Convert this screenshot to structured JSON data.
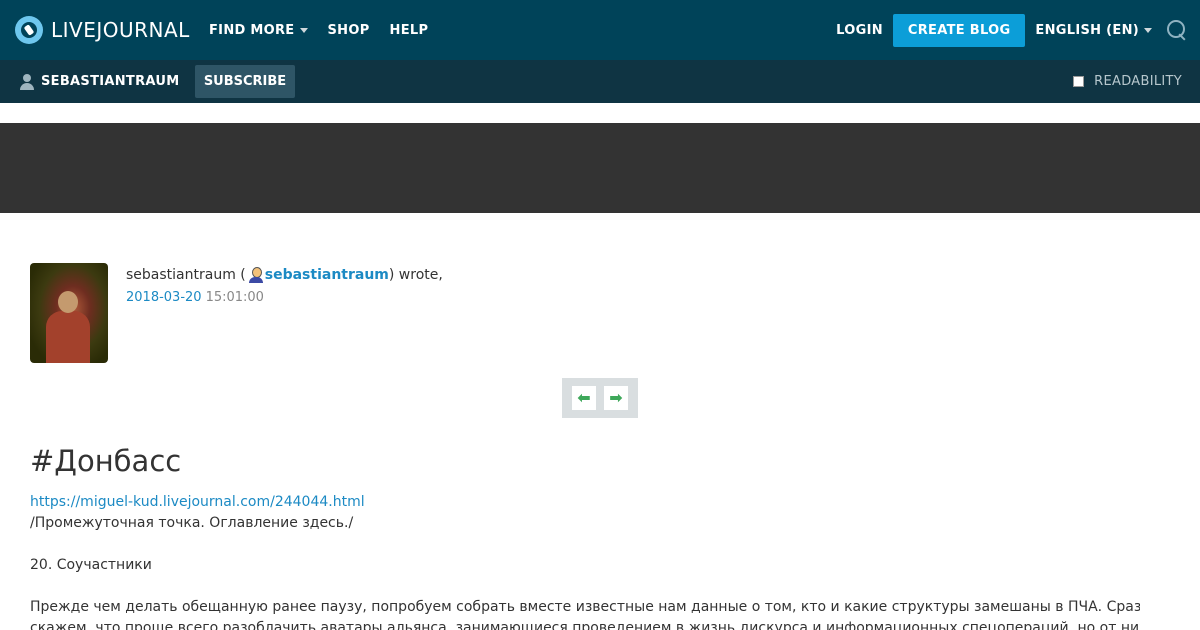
{
  "header": {
    "logo_text": "LIVEJOURNAL",
    "nav": [
      {
        "label": "FIND MORE",
        "has_dropdown": true
      },
      {
        "label": "SHOP",
        "has_dropdown": false
      },
      {
        "label": "HELP",
        "has_dropdown": false
      }
    ],
    "login_label": "LOGIN",
    "create_blog_label": "CREATE BLOG",
    "language_label": "ENGLISH (EN)",
    "icons": {
      "search": "search-icon",
      "logo": "livejournal-logo-icon"
    },
    "colors": {
      "top_bar": "#004359",
      "sub_bar": "#0f3443",
      "accent": "#0c9ed8"
    }
  },
  "subheader": {
    "journal_name": "SEBASTIANTRAUM",
    "subscribe_label": "SUBSCRIBE",
    "readability_label": "READABILITY"
  },
  "entry": {
    "author_display": "sebastiantraum (",
    "author_link": "sebastiantraum",
    "wrote_suffix": ") wrote,",
    "date": "2018-03-20",
    "time": "15:01:00",
    "title": "#Донбасс",
    "source_link": "https://miguel-kud.livejournal.com/244044.html",
    "paragraphs": [
      "/Промежуточная точка. Оглавление здесь./",
      "",
      "20. Соучастники",
      "",
      "Прежде чем делать обещанную ранее паузу, попробуем собрать вместе известные нам данные о том, кто и какие структуры замешаны в ПЧА. Сразу",
      "скажем, что проще всего разоблачить аватары альянса, занимающиеся проведением в жизнь дискурса и информационных спецопераций, но от них уходят"
    ]
  }
}
